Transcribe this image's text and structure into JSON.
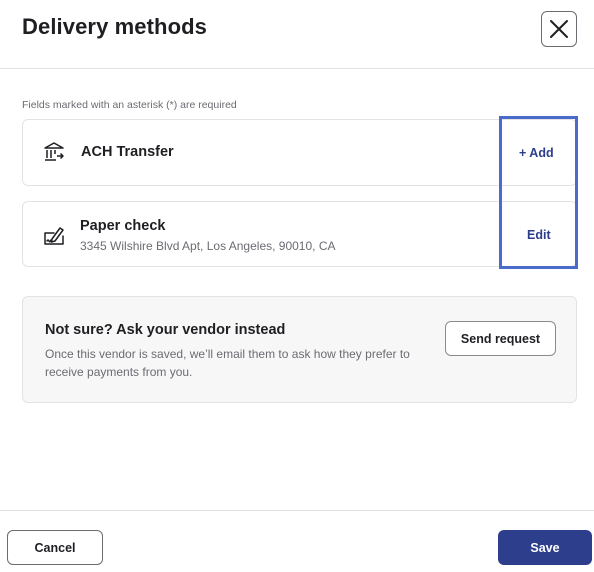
{
  "header": {
    "title": "Delivery methods",
    "close_icon": "close-icon"
  },
  "form": {
    "required_note": "Fields marked with an asterisk (*) are required"
  },
  "methods": [
    {
      "icon": "bank-transfer-icon",
      "name": "ACH Transfer",
      "action": "+ Add"
    },
    {
      "icon": "check-sign-icon",
      "name": "Paper check",
      "address": "3345 Wilshire Blvd Apt, Los Angeles, 90010, CA",
      "action": "Edit"
    }
  ],
  "vendor_request": {
    "title": "Not sure? Ask your vendor instead",
    "description": "Once this vendor is saved, we’ll email them to ask how they prefer to receive payments from you.",
    "button_label": "Send request"
  },
  "footer": {
    "cancel_label": "Cancel",
    "save_label": "Save"
  },
  "colors": {
    "primary": "#2c3e8c",
    "highlight": "#4a6bc9",
    "muted_text": "#6b6b72",
    "border": "#e3e3e6"
  }
}
